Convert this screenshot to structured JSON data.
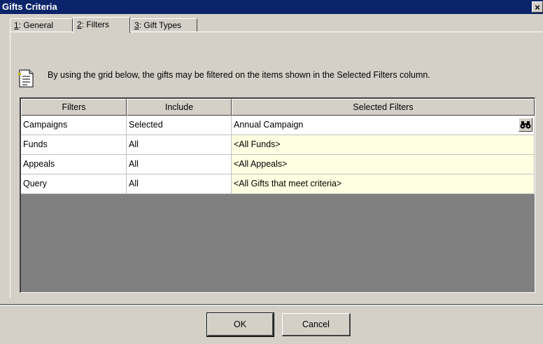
{
  "window": {
    "title": "Gifts Criteria",
    "close_label": "×"
  },
  "tabs": [
    {
      "hotkey": "1",
      "label": ": General",
      "active": false
    },
    {
      "hotkey": "2",
      "label": ": Filters",
      "active": true
    },
    {
      "hotkey": "3",
      "label": ": Gift Types",
      "active": false
    }
  ],
  "info": {
    "icon": "document-note-icon",
    "text": "By using the grid below, the gifts may be filtered on the items shown in the Selected Filters column."
  },
  "grid": {
    "columns": [
      "Filters",
      "Include",
      "Selected Filters"
    ],
    "rows": [
      {
        "filter": "Campaigns",
        "include": "Selected",
        "selected": "Annual Campaign"
      },
      {
        "filter": "Funds",
        "include": "All",
        "selected": "<All Funds>"
      },
      {
        "filter": "Appeals",
        "include": "All",
        "selected": "<All Appeals>"
      },
      {
        "filter": "Query",
        "include": "All",
        "selected": "<All Gifts that meet criteria>"
      }
    ],
    "lookup_icon": "binoculars-icon"
  },
  "buttons": {
    "ok": "OK",
    "cancel": "Cancel"
  },
  "colors": {
    "titlebar": "#0a246a",
    "dialog_bg": "#d4d0c8",
    "filter_cell_bg": "#ffffe1",
    "grid_empty_bg": "#808080"
  }
}
